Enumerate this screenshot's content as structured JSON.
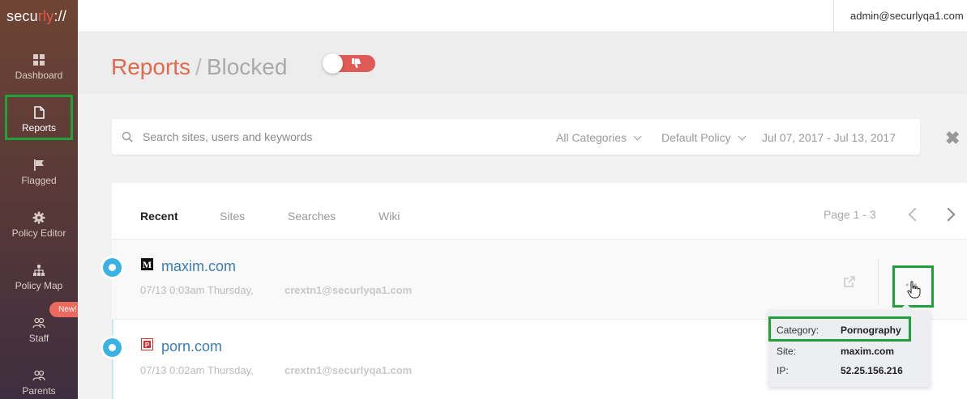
{
  "app": {
    "logo_prefix": "secu",
    "logo_accent": "rly",
    "logo_suffix": "://",
    "user_email": "admin@securlyqa1.com"
  },
  "sidebar": {
    "items": [
      {
        "label": "Dashboard",
        "icon": "dashboard-grid-icon"
      },
      {
        "label": "Reports",
        "icon": "document-icon"
      },
      {
        "label": "Flagged",
        "icon": "flag-icon"
      },
      {
        "label": "Policy Editor",
        "icon": "gear-icon"
      },
      {
        "label": "Policy Map",
        "icon": "sitemap-icon"
      },
      {
        "label": "Staff",
        "icon": "users-icon"
      },
      {
        "label": "Parents",
        "icon": "users-icon"
      }
    ],
    "new_badge": "New!"
  },
  "header": {
    "title": "Reports",
    "separator": "/",
    "subtitle": "Blocked",
    "toggle_state": "blocked"
  },
  "search": {
    "placeholder": "Search sites, users and keywords",
    "category_filter": "All Categories",
    "policy_filter": "Default Policy",
    "date_range": "Jul 07, 2017 - Jul 13, 2017",
    "clear_icon": "close-icon"
  },
  "tabs": [
    {
      "label": "Recent",
      "active": true
    },
    {
      "label": "Sites",
      "active": false
    },
    {
      "label": "Searches",
      "active": false
    },
    {
      "label": "Wiki",
      "active": false
    }
  ],
  "pagination": {
    "label": "Page 1 - 3"
  },
  "entries": [
    {
      "site": "maxim.com",
      "time": "07/13 0:03am Thursday,",
      "user": "crextn1@securlyqa1.com",
      "favicon": "maxim-m-icon"
    },
    {
      "site": "porn.com",
      "time": "07/13 0:02am Thursday,",
      "user": "crextn1@securlyqa1.com",
      "favicon": "porn-p-icon"
    }
  ],
  "popover": {
    "category_label": "Category:",
    "category_value": "Pornography",
    "site_label": "Site:",
    "site_value": "maxim.com",
    "ip_label": "IP:",
    "ip_value": "52.25.156.216"
  },
  "colors": {
    "brand_accent": "#e06a4f",
    "highlight_green": "#21a03a",
    "timeline_blue": "#3ab2e4",
    "link_blue": "#3a7db5"
  }
}
